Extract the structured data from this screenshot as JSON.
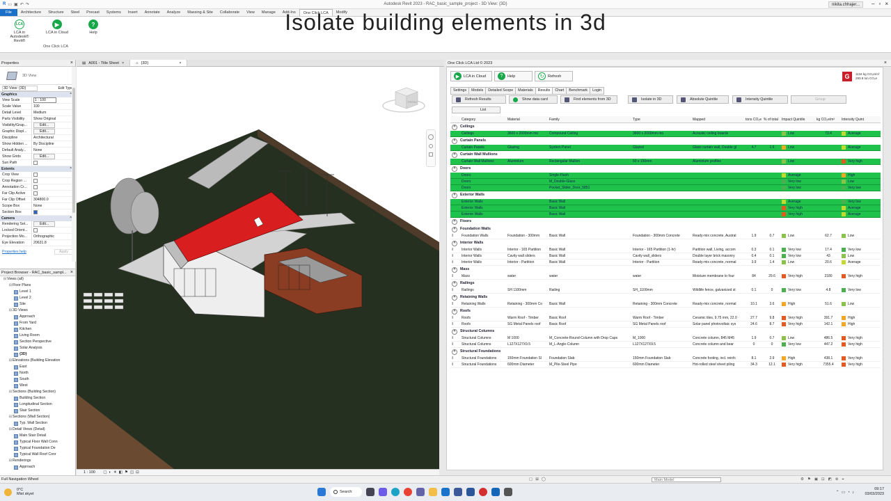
{
  "window_title": "Autodesk Revit 2023 - RAC_basic_sample_project - 3D View: {3D}",
  "user": "nikita.chhajer...",
  "overlay_title": "Isolate building elements in 3d",
  "ribbon_tabs": [
    "File",
    "Architecture",
    "Structure",
    "Steel",
    "Precast",
    "Systems",
    "Insert",
    "Annotate",
    "Analyze",
    "Massing & Site",
    "Collaborate",
    "View",
    "Manage",
    "Add-Ins",
    "One Click LCA",
    "Modify"
  ],
  "ribbon_buttons": [
    {
      "label": "LCA in Autodesk® Revit®",
      "icon": "lca-icon"
    },
    {
      "label": "LCA in Cloud",
      "icon": "play-icon"
    },
    {
      "label": "Help",
      "icon": "help-icon"
    }
  ],
  "ribbon_group": "One Click LCA",
  "properties": {
    "title": "Properties",
    "type_name": "3D View",
    "selector": "3D View: {3D}",
    "edit_type": "Edit Type",
    "graphics_cat": "Graphics",
    "extents_cat": "Extents",
    "camera_cat": "Camera",
    "rows_graphics": [
      {
        "k": "View Scale",
        "v": "1 : 100"
      },
      {
        "k": "Scale Value",
        "v": "100"
      },
      {
        "k": "Detail Level",
        "v": "Medium"
      },
      {
        "k": "Parts Visibility",
        "v": "Show Original"
      },
      {
        "k": "Visibility/Grap...",
        "v": "Edit..."
      },
      {
        "k": "Graphic Displ...",
        "v": "Edit..."
      },
      {
        "k": "Discipline",
        "v": "Architectural"
      },
      {
        "k": "Show Hidden ...",
        "v": "By Discipline"
      },
      {
        "k": "Default Analy...",
        "v": "None"
      },
      {
        "k": "Show Grids",
        "v": "Edit..."
      },
      {
        "k": "Sun Path",
        "v": ""
      }
    ],
    "rows_extents": [
      {
        "k": "Crop View",
        "v": ""
      },
      {
        "k": "Crop Region ...",
        "v": ""
      },
      {
        "k": "Annotation Cr...",
        "v": ""
      },
      {
        "k": "Far Clip Active",
        "v": ""
      },
      {
        "k": "Far Clip Offset",
        "v": "304800.0"
      },
      {
        "k": "Scope Box",
        "v": "None"
      },
      {
        "k": "Section Box",
        "v": ""
      }
    ],
    "rows_camera": [
      {
        "k": "Rendering Set...",
        "v": "Edit..."
      },
      {
        "k": "Locked Orient...",
        "v": ""
      },
      {
        "k": "Projection Mo...",
        "v": "Orthographic"
      },
      {
        "k": "Eye Elevation",
        "v": "20631.8"
      }
    ],
    "help_link": "Properties help",
    "apply": "Apply"
  },
  "browser": {
    "title": "Project Browser - RAC_basic_sampl...",
    "items": [
      {
        "t": "Views (all)",
        "lvl": 0,
        "tg": "⊟"
      },
      {
        "t": "Floor Plans",
        "lvl": 1,
        "tg": "⊟"
      },
      {
        "t": "Level 1",
        "lvl": 2
      },
      {
        "t": "Level 2",
        "lvl": 2
      },
      {
        "t": "Site",
        "lvl": 2
      },
      {
        "t": "3D Views",
        "lvl": 1,
        "tg": "⊟"
      },
      {
        "t": "Approach",
        "lvl": 2
      },
      {
        "t": "From Yard",
        "lvl": 2
      },
      {
        "t": "Kitchen",
        "lvl": 2
      },
      {
        "t": "Living Room",
        "lvl": 2
      },
      {
        "t": "Section Perspective",
        "lvl": 2
      },
      {
        "t": "Solar Analysis",
        "lvl": 2
      },
      {
        "t": "{3D}",
        "lvl": 2,
        "bold": true
      },
      {
        "t": "Elevations (Building Elevation",
        "lvl": 1,
        "tg": "⊟"
      },
      {
        "t": "East",
        "lvl": 2
      },
      {
        "t": "North",
        "lvl": 2
      },
      {
        "t": "South",
        "lvl": 2
      },
      {
        "t": "West",
        "lvl": 2
      },
      {
        "t": "Sections (Building Section)",
        "lvl": 1,
        "tg": "⊟"
      },
      {
        "t": "Building Section",
        "lvl": 2
      },
      {
        "t": "Longitudinal Section",
        "lvl": 2
      },
      {
        "t": "Stair Section",
        "lvl": 2
      },
      {
        "t": "Sections (Wall Section)",
        "lvl": 1,
        "tg": "⊟"
      },
      {
        "t": "Typ. Wall Section",
        "lvl": 2
      },
      {
        "t": "Detail Views (Detail)",
        "lvl": 1,
        "tg": "⊟"
      },
      {
        "t": "Main Stair Detail",
        "lvl": 2
      },
      {
        "t": "Typical Floor Wall Conn",
        "lvl": 2
      },
      {
        "t": "Typical Foundation De",
        "lvl": 2
      },
      {
        "t": "Typical Wall Roof Conr",
        "lvl": 2
      },
      {
        "t": "Renderings",
        "lvl": 1,
        "tg": "⊟"
      },
      {
        "t": "Approach",
        "lvl": 2
      }
    ]
  },
  "view_tabs": [
    {
      "label": "A001 - Title Sheet",
      "active": false
    },
    {
      "label": "{3D}",
      "active": true
    }
  ],
  "view_scale": "1 : 100",
  "viewcube_label": "FRONT",
  "status": "Full Navigation Wheel",
  "model_field": "Main Model",
  "lca": {
    "header": "One Click LCA Ltd © 2023",
    "buttons": [
      {
        "label": "LCA in Cloud",
        "icon": "play-icon"
      },
      {
        "label": "Help",
        "icon": "help-icon"
      },
      {
        "label": "Refresh",
        "icon": "refresh-icon"
      }
    ],
    "summary_line1": "1134 kg CO₂e/m²",
    "summary_line2": "283.8 ton CO₂e",
    "tabs": [
      "Settings",
      "Models",
      "Detailed Scope",
      "Materials",
      "Results",
      "Chart",
      "Benchmark",
      "Login"
    ],
    "active_tab": "Results",
    "toolbar": [
      "Refresh Results",
      "Show data card",
      "Find elements from 3D",
      "Isolate in 3D",
      "Absolute Quintile",
      "Intensity Quintile",
      "Group"
    ],
    "list_button": "List",
    "columns": [
      "",
      "Category",
      "Material",
      "Family",
      "Type",
      "Mapped",
      "tons CO₂e",
      "% of total",
      "Impact Quintile",
      "kg CO₂e/m²",
      "Intensity Quint"
    ],
    "groups": [
      {
        "name": "Ceilings",
        "rows": [
          {
            "sel": true,
            "cat": "Ceilings",
            "mat": "3600 x 2000mm mo",
            "fam": "Compound Ceiling",
            "type": "3600 x 2000mm mo",
            "map": "Acoustic ceiling boards",
            "tons": "",
            "pct": "",
            "imp": "Low",
            "impc": "#8bc34a",
            "kg": "73.4",
            "int": "Average",
            "intc": "#c6d82e"
          }
        ]
      },
      {
        "name": "Curtain Panels",
        "rows": [
          {
            "sel": true,
            "cat": "Curtain Panels",
            "mat": "Glazing",
            "fam": "System Panel",
            "type": "Glazed",
            "map": "Glass curtain wall, Double gl",
            "tons": "4.7",
            "pct": "1.6",
            "imp": "Low",
            "impc": "#f5a623",
            "kg": "",
            "int": "Average",
            "intc": "#c6d82e"
          }
        ]
      },
      {
        "name": "Curtain Wall Mullions",
        "rows": [
          {
            "sel": true,
            "cat": "Curtain Wall Mullions",
            "mat": "Aluminium",
            "fam": "Rectangular Mullion",
            "type": "50 x 150mm",
            "map": "Aluminium profiles",
            "tons": "",
            "pct": "",
            "imp": "Low",
            "impc": "#8bc34a",
            "kg": "",
            "int": "Very high",
            "intc": "#e8571e"
          }
        ]
      },
      {
        "name": "Doors",
        "rows": [
          {
            "sel": true,
            "cat": "Doors",
            "mat": "",
            "fam": "Single-Flush",
            "type": "",
            "map": "",
            "tons": "",
            "pct": "",
            "imp": "Average",
            "impc": "#c6d82e",
            "kg": "",
            "int": "High",
            "intc": "#f5a623"
          },
          {
            "sel": true,
            "cat": "Doors",
            "mat": "",
            "fam": "M_Double-Glass",
            "type": "",
            "map": "",
            "tons": "",
            "pct": "",
            "imp": "Very low",
            "impc": "#4caf50",
            "kg": "",
            "int": "Low",
            "intc": "#8bc34a"
          },
          {
            "sel": true,
            "cat": "Doors",
            "mat": "",
            "fam": "Pocket_Slider_Door_5851",
            "type": "",
            "map": "",
            "tons": "",
            "pct": "",
            "imp": "Very low",
            "impc": "#4caf50",
            "kg": "",
            "int": "Very low",
            "intc": "#4caf50"
          }
        ]
      },
      {
        "name": "Exterior Walls",
        "rows": [
          {
            "sel": true,
            "cat": "Exterior Walls",
            "mat": "",
            "fam": "Basic Wall",
            "type": "",
            "map": "",
            "tons": "",
            "pct": "",
            "imp": "Average",
            "impc": "#c6d82e",
            "kg": "",
            "int": "Very low",
            "intc": "#4caf50"
          },
          {
            "sel": true,
            "cat": "Exterior Walls",
            "mat": "",
            "fam": "Basic Wall",
            "type": "",
            "map": "",
            "tons": "",
            "pct": "",
            "imp": "Very high",
            "impc": "#e8571e",
            "kg": "",
            "int": "Average",
            "intc": "#c6d82e"
          },
          {
            "sel": true,
            "cat": "Exterior Walls",
            "mat": "",
            "fam": "Basic Wall",
            "type": "",
            "map": "",
            "tons": "",
            "pct": "",
            "imp": "Very high",
            "impc": "#e8571e",
            "kg": "",
            "int": "Average",
            "intc": "#c6d82e"
          }
        ]
      },
      {
        "name": "Floors",
        "rows": []
      },
      {
        "name": "Foundation Walls",
        "rows": [
          {
            "sel": false,
            "cat": "Foundation Walls",
            "mat": "Foundation - 300mm",
            "fam": "Basic Wall",
            "type": "Foundation - 300mm Concrete",
            "map": "Ready-mix concrete, Austral",
            "tons": "1.9",
            "pct": "0.7",
            "imp": "Low",
            "impc": "#8bc34a",
            "kg": "62.7",
            "int": "Low",
            "intc": "#8bc34a"
          }
        ]
      },
      {
        "name": "Interior Walls",
        "rows": [
          {
            "sel": false,
            "cat": "Interior Walls",
            "mat": "Interior - 165 Partition",
            "fam": "Basic Wall",
            "type": "Interior - 165 Partition (1-hr)",
            "map": "Partition wall, Living, accom",
            "tons": "0.3",
            "pct": "0.1",
            "imp": "Very low",
            "impc": "#4caf50",
            "kg": "17.4",
            "int": "Very low",
            "intc": "#4caf50"
          },
          {
            "sel": false,
            "cat": "Interior Walls",
            "mat": "Cavity wall sliders",
            "fam": "Basic Wall",
            "type": "Cavity wall_sliders",
            "map": "Double layer brick masonry",
            "tons": "0.4",
            "pct": "0.1",
            "imp": "Very low",
            "impc": "#4caf50",
            "kg": "43",
            "int": "Low",
            "intc": "#8bc34a"
          },
          {
            "sel": false,
            "cat": "Interior Walls",
            "mat": "Interior - Partition",
            "fam": "Basic Wall",
            "type": "Interior - Partition",
            "map": "Ready-mix concrete, normal",
            "tons": "3.9",
            "pct": "1.4",
            "imp": "Low",
            "impc": "#8bc34a",
            "kg": "20.6",
            "int": "Average",
            "intc": "#c6d82e"
          }
        ]
      },
      {
        "name": "Mass",
        "rows": [
          {
            "sel": false,
            "cat": "Mass",
            "mat": "water",
            "fam": "water",
            "type": "water",
            "map": "Moisture membrane to four",
            "tons": "84",
            "pct": "29.6",
            "imp": "Very high",
            "impc": "#e8571e",
            "kg": "2180",
            "int": "Very high",
            "intc": "#e8571e"
          }
        ]
      },
      {
        "name": "Railings",
        "rows": [
          {
            "sel": false,
            "cat": "Railings",
            "mat": "SH 1100mm",
            "fam": "Railing",
            "type": "SH_1100mm",
            "map": "Wildlife fence, galvanized st",
            "tons": "0.1",
            "pct": "0",
            "imp": "Very low",
            "impc": "#4caf50",
            "kg": "4.8",
            "int": "Very low",
            "intc": "#4caf50"
          }
        ]
      },
      {
        "name": "Retaining Walls",
        "rows": [
          {
            "sel": false,
            "cat": "Retaining Walls",
            "mat": "Retaining - 300mm Co",
            "fam": "Basic Wall",
            "type": "Retaining - 300mm Concrete",
            "map": "Ready-mix concrete, normal",
            "tons": "10.1",
            "pct": "3.6",
            "imp": "High",
            "impc": "#f5a623",
            "kg": "51.6",
            "int": "Low",
            "intc": "#8bc34a"
          }
        ]
      },
      {
        "name": "Roofs",
        "rows": [
          {
            "sel": false,
            "cat": "Roofs",
            "mat": "Warm Roof - Timber",
            "fam": "Basic Roof",
            "type": "Warm Roof - Timber",
            "map": "Ceramic tiles, 9.75 mm, 22.0",
            "tons": "27.7",
            "pct": "9.8",
            "imp": "Very high",
            "impc": "#e8571e",
            "kg": "391.7",
            "int": "High",
            "intc": "#f5a623"
          },
          {
            "sel": false,
            "cat": "Roofs",
            "mat": "SG Metal Panels roof",
            "fam": "Basic Roof",
            "type": "SG Metal Panels roof",
            "map": "Solar panel photovoltaic sys",
            "tons": "24.6",
            "pct": "8.7",
            "imp": "Very high",
            "impc": "#e8571e",
            "kg": "142.1",
            "int": "High",
            "intc": "#f5a623"
          }
        ]
      },
      {
        "name": "Structural Columns",
        "rows": [
          {
            "sel": false,
            "cat": "Structural Columns",
            "mat": "M 1000",
            "fam": "M_Concrete-Round-Column with Drop Caps",
            "type": "M_1000",
            "map": "Concrete column, 845 M45",
            "tons": "1.9",
            "pct": "0.7",
            "imp": "Low",
            "impc": "#8bc34a",
            "kg": "486.5",
            "int": "Very high",
            "intc": "#e8571e"
          },
          {
            "sel": false,
            "cat": "Structural Columns",
            "mat": "L127X127X9.5",
            "fam": "M_L-Angle-Column",
            "type": "L127X127X9.5",
            "map": "Concrete column and bear",
            "tons": "0",
            "pct": "0",
            "imp": "Very low",
            "impc": "#4caf50",
            "kg": "447.2",
            "int": "Very high",
            "intc": "#e8571e"
          }
        ]
      },
      {
        "name": "Structural Foundations",
        "rows": [
          {
            "sel": false,
            "cat": "Structural Foundations",
            "mat": "150mm Foundation Sl",
            "fam": "Foundation Slab",
            "type": "150mm Foundation Slab",
            "map": "Concrete footing, incl. reinfc",
            "tons": "8.1",
            "pct": "2.9",
            "imp": "High",
            "impc": "#f5a623",
            "kg": "438.1",
            "int": "Very high",
            "intc": "#e8571e"
          },
          {
            "sel": false,
            "cat": "Structural Foundations",
            "mat": "600mm Diameter",
            "fam": "M_Pile-Steel Pipe",
            "type": "600mm Diameter",
            "map": "Hot-rolled steel sheet piling",
            "tons": "34.3",
            "pct": "12.1",
            "imp": "Very high",
            "impc": "#e8571e",
            "kg": "7355.4",
            "int": "Very high",
            "intc": "#e8571e"
          }
        ]
      }
    ]
  },
  "taskbar": {
    "temp": "0°C",
    "weather": "Mist skyet",
    "search": "Search",
    "time": "09:17",
    "date": "03/03/2023"
  }
}
